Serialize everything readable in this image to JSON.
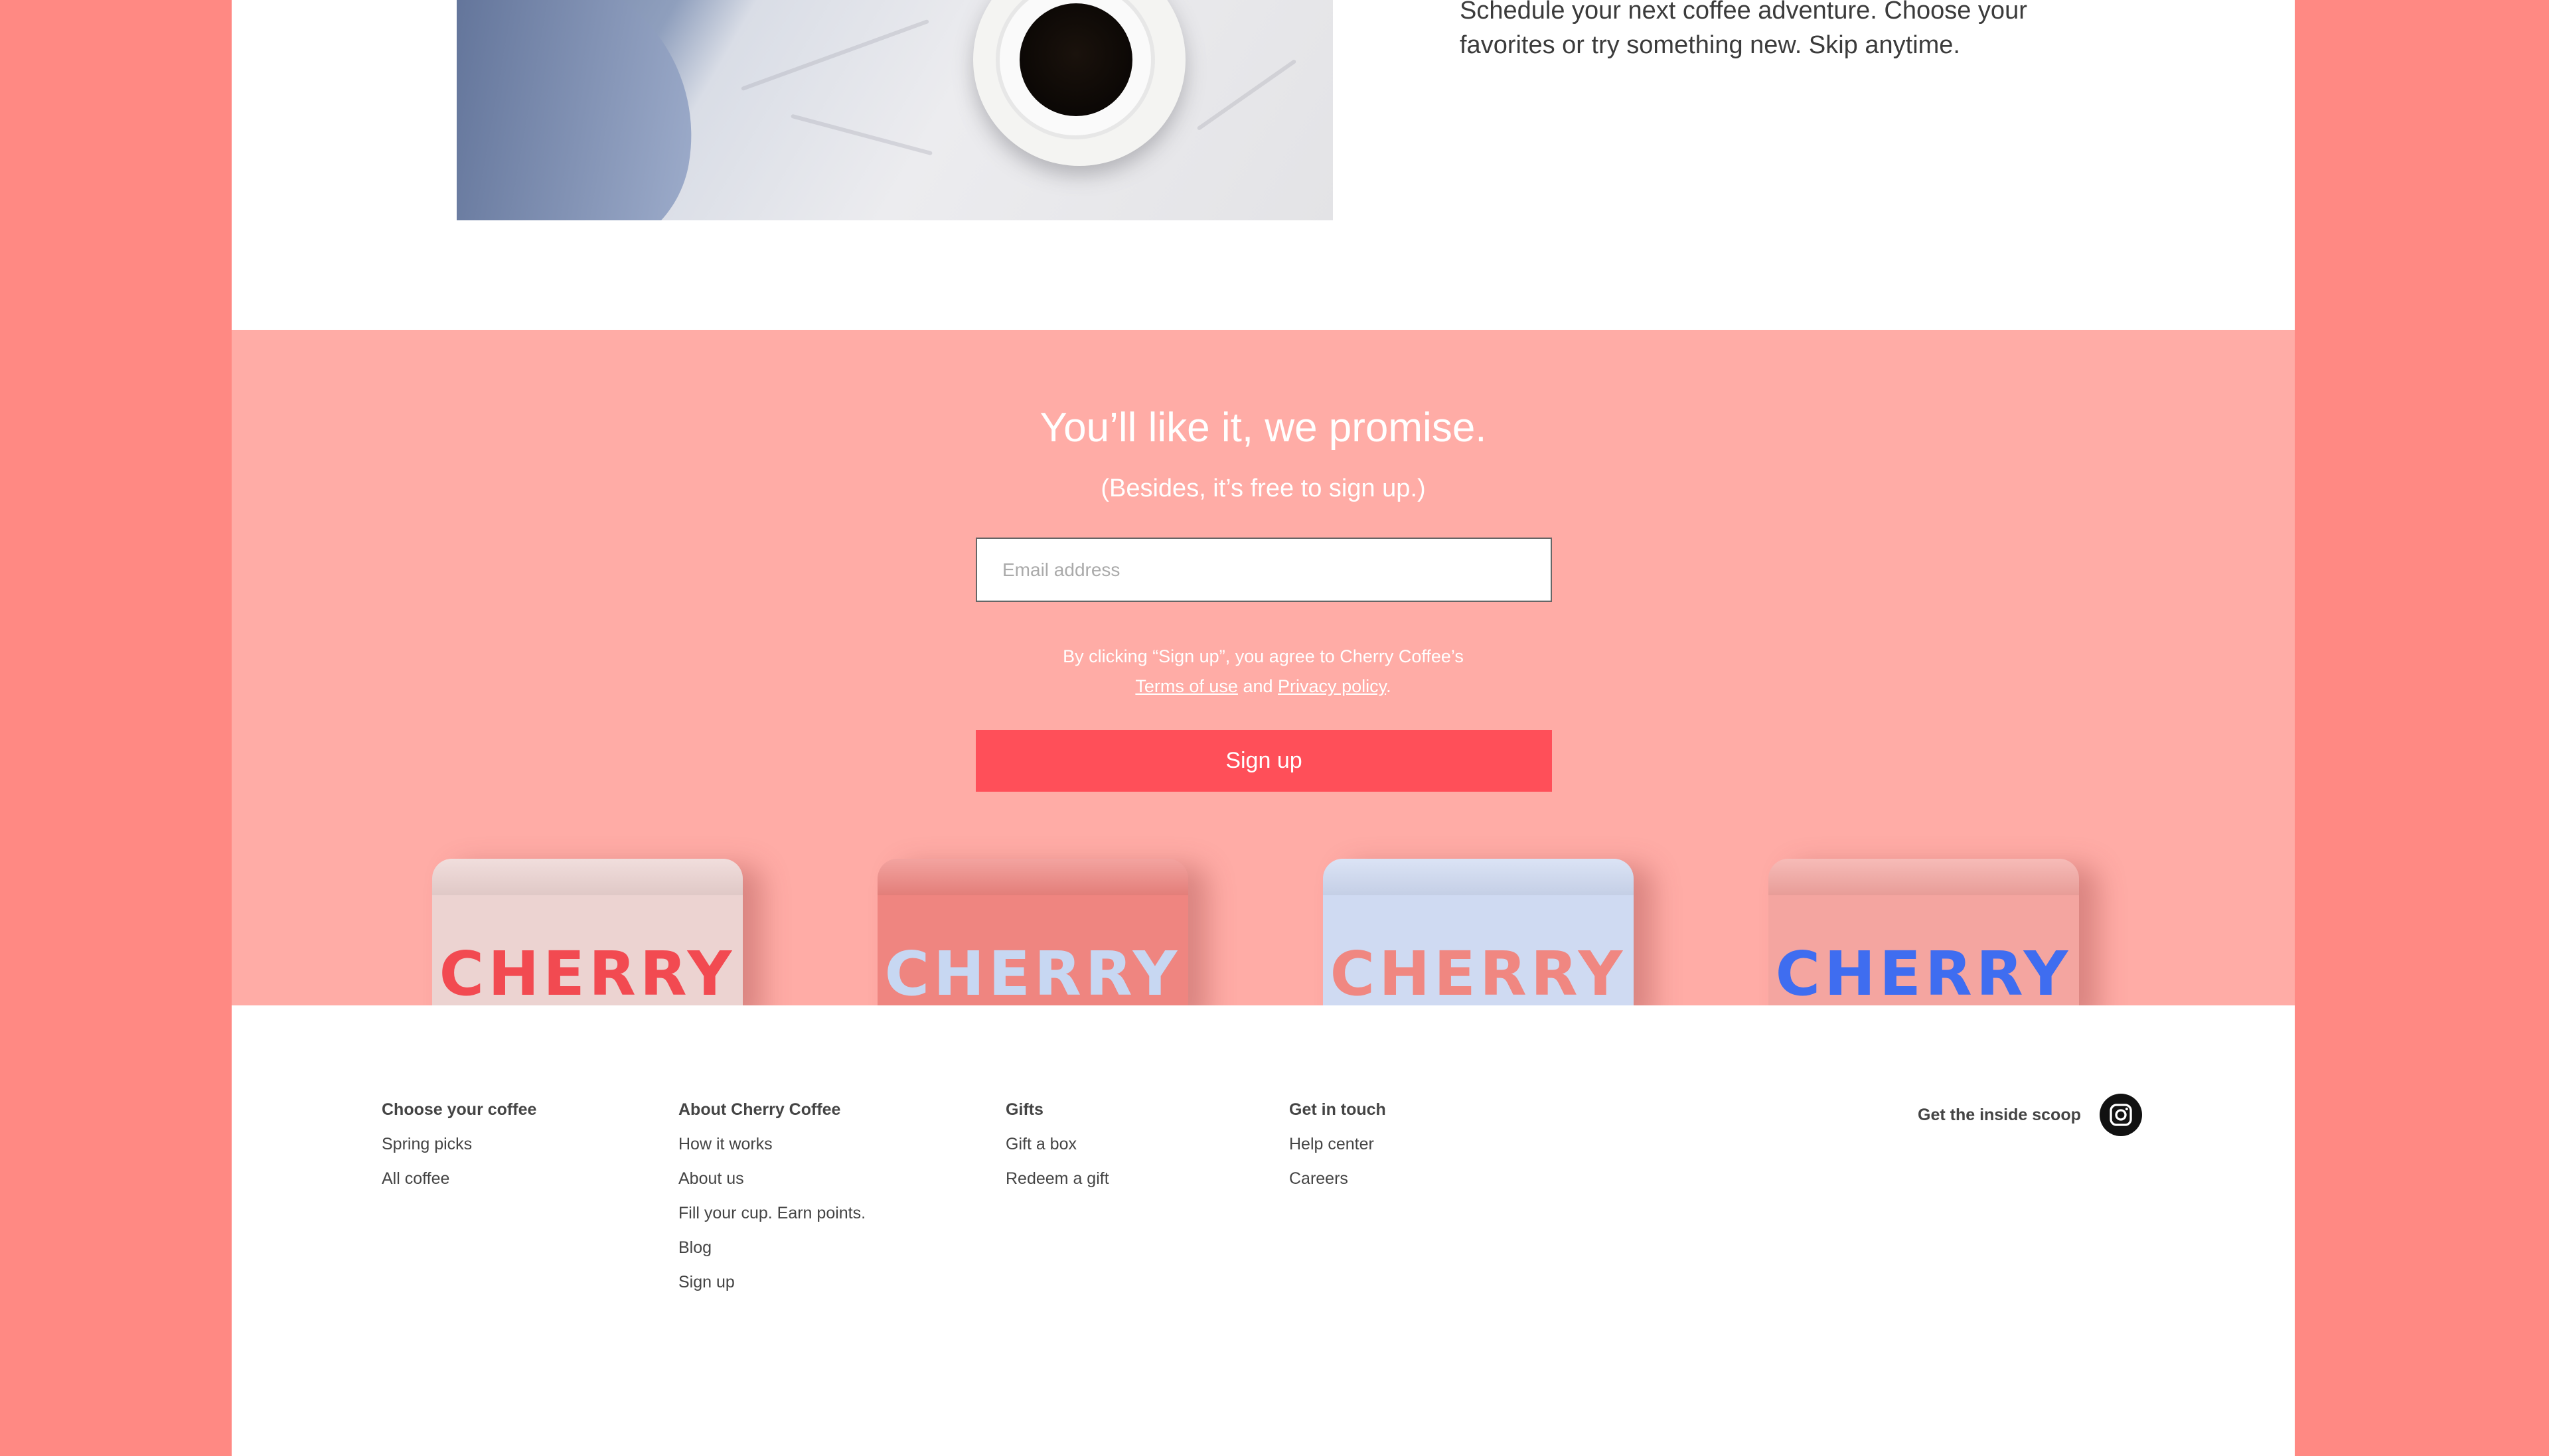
{
  "intro": {
    "text": "Schedule your next coffee adventure. Choose your favorites or try something new. Skip anytime."
  },
  "signup": {
    "title": "You’ll like it, we promise.",
    "subtitle": "(Besides, it’s free to sign up.)",
    "email_placeholder": "Email address",
    "legal_prefix": "By clicking “Sign up”, you agree to Cherry Coffee’s",
    "terms_link": "Terms of use",
    "legal_and": "and",
    "privacy_link": "Privacy policy",
    "legal_suffix": ".",
    "button_label": "Sign up"
  },
  "bags": [
    {
      "label": "CHERRY",
      "bag_color": "#ecd3d1",
      "text_color": "#f24a51"
    },
    {
      "label": "CHERRY",
      "bag_color": "#ef8580",
      "text_color": "#c7d7f2"
    },
    {
      "label": "CHERRY",
      "bag_color": "#cfdaf2",
      "text_color": "#f08781"
    },
    {
      "label": "CHERRY",
      "bag_color": "#f4a5a0",
      "text_color": "#3f6df0"
    }
  ],
  "footer": {
    "columns": [
      {
        "heading": "Choose your coffee",
        "links": [
          "Spring picks",
          "All coffee"
        ]
      },
      {
        "heading": "About Cherry Coffee",
        "links": [
          "How it works",
          "About us",
          "Fill your cup. Earn points.",
          "Blog",
          "Sign up"
        ]
      },
      {
        "heading": "Gifts",
        "links": [
          "Gift a box",
          "Redeem a gift"
        ]
      },
      {
        "heading": "Get in touch",
        "links": [
          "Help center",
          "Careers"
        ]
      }
    ],
    "social_label": "Get the inside scoop",
    "social_icon": "instagram-icon"
  },
  "colors": {
    "outer_background": "#ff8983",
    "signup_band": "#ffaca6",
    "accent_button": "#ff4f59"
  }
}
